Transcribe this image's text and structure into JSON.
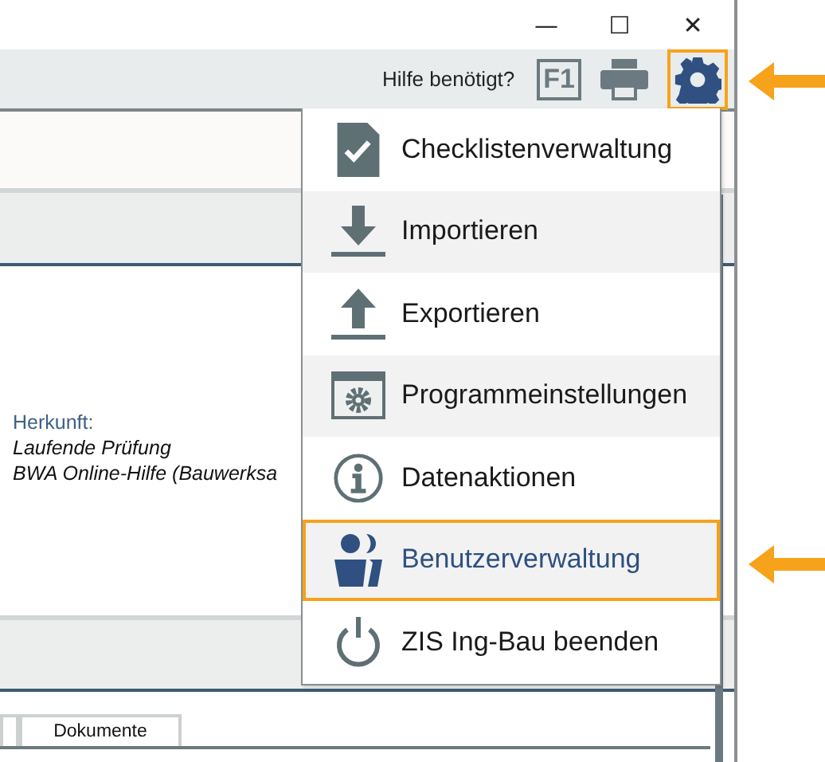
{
  "window_controls": [
    "—",
    "☐",
    "✕"
  ],
  "toolbar": {
    "help_text": "Hilfe benötigt?",
    "f1_label": "F1",
    "settings_highlighted": true
  },
  "details": {
    "label": "Herkunft:",
    "lines": [
      "Laufende Prüfung",
      "BWA Online-Hilfe (Bauwerksa"
    ]
  },
  "tabs": [
    {
      "selected": false
    },
    {
      "label": "Dokumente",
      "selected": false
    }
  ],
  "menu": [
    {
      "kind": "checklist",
      "label": "Checklistenverwaltung",
      "selected": false
    },
    {
      "kind": "import",
      "label": "Importieren",
      "selected": false
    },
    {
      "kind": "export",
      "label": "Exportieren",
      "selected": false
    },
    {
      "kind": "settings",
      "label": "Programmeinstellungen",
      "selected": false
    },
    {
      "kind": "info",
      "label": "Datenaktionen",
      "selected": false
    },
    {
      "kind": "users",
      "label": "Benutzerverwaltung",
      "selected": true
    },
    {
      "kind": "power",
      "label": "ZIS Ing-Bau beenden",
      "selected": false
    }
  ]
}
